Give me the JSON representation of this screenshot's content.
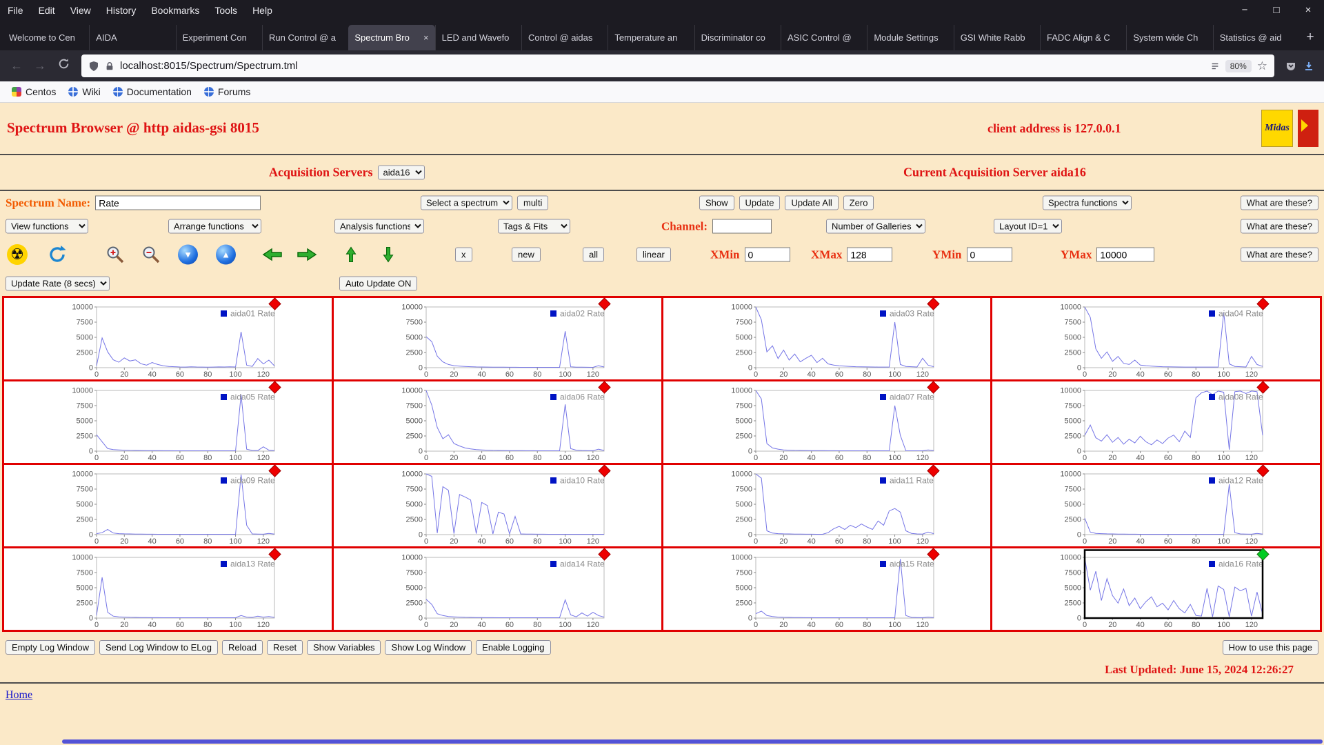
{
  "browser": {
    "menu": [
      "File",
      "Edit",
      "View",
      "History",
      "Bookmarks",
      "Tools",
      "Help"
    ],
    "window_controls": {
      "minimize": "−",
      "maximize": "□",
      "close": "×"
    },
    "tabs": [
      "Welcome to Cen",
      "AIDA",
      "Experiment Con",
      "Run Control @ a",
      "Spectrum Bro",
      "LED and Wavefo",
      "Control @ aidas",
      "Temperature an",
      "Discriminator co",
      "ASIC Control @",
      "Module Settings",
      "GSI White Rabb",
      "FADC Align & C",
      "System wide Ch",
      "Statistics @ aid"
    ],
    "active_tab": 4,
    "new_tab": "+",
    "url": "localhost:8015/Spectrum/Spectrum.tml",
    "zoom": "80%",
    "bookmarks": [
      "Centos",
      "Wiki",
      "Documentation",
      "Forums"
    ]
  },
  "header": {
    "title": "Spectrum Browser @ http aidas-gsi 8015",
    "client": "client address is 127.0.0.1",
    "logo_text": "Midas"
  },
  "acquisition": {
    "label": "Acquisition Servers",
    "selected": "aida16",
    "current": "Current Acquisition Server aida16"
  },
  "controls": {
    "spectrum_name_label": "Spectrum Name:",
    "spectrum_name_value": "Rate",
    "select_spectrum": "Select a spectrum",
    "multi": "multi",
    "show": "Show",
    "update": "Update",
    "update_all": "Update All",
    "zero": "Zero",
    "spectra_functions": "Spectra functions",
    "what_are_these": "What are these?",
    "view_functions": "View functions",
    "arrange_functions": "Arrange functions",
    "analysis_functions": "Analysis functions",
    "tags_fits": "Tags & Fits",
    "channel_label": "Channel:",
    "channel_value": "",
    "number_of_galleries": "Number of Galleries",
    "layout_id": "Layout ID=1",
    "x_btn": "x",
    "new_btn": "new",
    "all_btn": "all",
    "linear_btn": "linear",
    "xmin_label": "XMin",
    "xmin_value": "0",
    "xmax_label": "XMax",
    "xmax_value": "128",
    "ymin_label": "YMin",
    "ymin_value": "0",
    "ymax_label": "YMax",
    "ymax_value": "10000",
    "update_rate": "Update Rate (8 secs)",
    "auto_update": "Auto Update ON"
  },
  "footer": {
    "buttons": [
      "Empty Log Window",
      "Send Log Window to ELog",
      "Reload",
      "Reset",
      "Show Variables",
      "Show Log Window",
      "Enable Logging"
    ],
    "help": "How to use this page",
    "last_updated": "Last Updated: June 15, 2024 12:26:27",
    "home": "Home"
  },
  "chart_data": {
    "type": "line",
    "xlabel": "",
    "ylabel": "",
    "xlim": [
      0,
      128
    ],
    "ylim": [
      0,
      10000
    ],
    "x_ticks": [
      0,
      20,
      40,
      60,
      80,
      100,
      120
    ],
    "y_ticks": [
      0,
      2500,
      5000,
      7500,
      10000
    ],
    "x_step": 4,
    "line_color": "#7575e6",
    "legend_marker_color": "#0013c4",
    "charts": [
      {
        "name": "aida01 Rate",
        "diamond": "#ee0000",
        "values": [
          300,
          4900,
          2600,
          1300,
          900,
          1600,
          1100,
          1300,
          650,
          420,
          850,
          520,
          320,
          210,
          160,
          110,
          100,
          150,
          110,
          100,
          90,
          100,
          130,
          110,
          150,
          110,
          5900,
          420,
          210,
          1500,
          620,
          1250,
          300
        ]
      },
      {
        "name": "aida02 Rate",
        "diamond": "#ee0000",
        "values": [
          5100,
          4300,
          1900,
          950,
          520,
          330,
          260,
          210,
          160,
          130,
          110,
          100,
          90,
          80,
          80,
          70,
          70,
          60,
          60,
          60,
          60,
          60,
          60,
          60,
          60,
          6000,
          150,
          90,
          80,
          70,
          60,
          320,
          110
        ]
      },
      {
        "name": "aida03 Rate",
        "diamond": "#ee0000",
        "values": [
          10000,
          7900,
          2600,
          3600,
          1500,
          2900,
          1250,
          2250,
          950,
          1550,
          2050,
          850,
          1550,
          620,
          420,
          320,
          260,
          210,
          160,
          150,
          130,
          110,
          100,
          100,
          110,
          7500,
          520,
          210,
          160,
          110,
          1550,
          420,
          160
        ]
      },
      {
        "name": "aida04 Rate",
        "diamond": "#ee0000",
        "values": [
          10000,
          8300,
          3100,
          1550,
          2600,
          1050,
          1850,
          720,
          520,
          1250,
          420,
          330,
          260,
          210,
          160,
          150,
          130,
          110,
          100,
          100,
          100,
          100,
          100,
          100,
          110,
          9100,
          620,
          210,
          160,
          110,
          1850,
          520,
          210
        ]
      },
      {
        "name": "aida05 Rate",
        "diamond": "#ee0000",
        "values": [
          2700,
          1550,
          420,
          260,
          210,
          160,
          130,
          110,
          100,
          90,
          80,
          80,
          70,
          70,
          60,
          60,
          60,
          60,
          60,
          60,
          60,
          60,
          60,
          60,
          60,
          60,
          9300,
          320,
          110,
          90,
          720,
          160,
          90
        ]
      },
      {
        "name": "aida06 Rate",
        "diamond": "#ee0000",
        "values": [
          10000,
          7600,
          3900,
          2050,
          2700,
          1250,
          850,
          520,
          360,
          260,
          210,
          160,
          130,
          110,
          100,
          90,
          80,
          80,
          70,
          70,
          60,
          60,
          60,
          60,
          60,
          7700,
          420,
          160,
          110,
          90,
          80,
          320,
          110
        ]
      },
      {
        "name": "aida07 Rate",
        "diamond": "#ee0000",
        "values": [
          10000,
          8600,
          1250,
          520,
          330,
          210,
          160,
          130,
          110,
          100,
          90,
          80,
          80,
          70,
          70,
          60,
          60,
          60,
          60,
          60,
          60,
          60,
          60,
          60,
          60,
          7500,
          2600,
          60,
          60,
          60,
          60,
          210,
          90
        ]
      },
      {
        "name": "aida08 Rate",
        "diamond": "#ee0000",
        "values": [
          2600,
          4300,
          2200,
          1650,
          2700,
          1450,
          2250,
          1150,
          1950,
          1350,
          2450,
          1550,
          1050,
          1850,
          1250,
          2150,
          2650,
          1550,
          3300,
          2250,
          8800,
          9600,
          9900,
          9300,
          9900,
          9700,
          250,
          9800,
          9900,
          9500,
          9900,
          9800,
          2600
        ]
      },
      {
        "name": "aida09 Rate",
        "diamond": "#ee0000",
        "values": [
          160,
          320,
          850,
          260,
          160,
          130,
          110,
          90,
          80,
          70,
          70,
          60,
          60,
          60,
          60,
          60,
          60,
          60,
          60,
          60,
          60,
          60,
          60,
          60,
          60,
          60,
          9900,
          1550,
          110,
          90,
          70,
          210,
          90
        ]
      },
      {
        "name": "aida10 Rate",
        "diamond": "#ee0000",
        "values": [
          10000,
          9600,
          250,
          7900,
          7300,
          160,
          6600,
          6200,
          5700,
          160,
          5300,
          4800,
          110,
          3700,
          3400,
          110,
          3000,
          110,
          90,
          80,
          70,
          70,
          60,
          60,
          60,
          60,
          60,
          60,
          60,
          60,
          60,
          60,
          60
        ]
      },
      {
        "name": "aida11 Rate",
        "diamond": "#ee0000",
        "values": [
          10000,
          9300,
          620,
          260,
          160,
          130,
          110,
          90,
          80,
          70,
          70,
          60,
          60,
          320,
          950,
          1350,
          850,
          1550,
          1150,
          1750,
          1250,
          850,
          2250,
          1550,
          3900,
          4300,
          3700,
          620,
          210,
          110,
          90,
          420,
          160
        ]
      },
      {
        "name": "aida12 Rate",
        "diamond": "#ee0000",
        "values": [
          2700,
          420,
          210,
          160,
          130,
          110,
          90,
          80,
          70,
          70,
          60,
          60,
          60,
          60,
          60,
          60,
          60,
          60,
          60,
          60,
          60,
          60,
          60,
          60,
          60,
          60,
          8300,
          320,
          110,
          90,
          70,
          210,
          90
        ]
      },
      {
        "name": "aida13 Rate",
        "diamond": "#ee0000",
        "values": [
          420,
          6700,
          950,
          320,
          210,
          160,
          130,
          110,
          90,
          80,
          70,
          70,
          60,
          60,
          60,
          60,
          60,
          60,
          60,
          60,
          60,
          60,
          60,
          60,
          60,
          60,
          420,
          160,
          110,
          320,
          160,
          260,
          110
        ]
      },
      {
        "name": "aida14 Rate",
        "diamond": "#ee0000",
        "values": [
          3100,
          2250,
          720,
          420,
          260,
          210,
          160,
          130,
          110,
          90,
          80,
          70,
          70,
          60,
          60,
          60,
          60,
          60,
          60,
          60,
          60,
          60,
          60,
          60,
          60,
          3000,
          520,
          210,
          850,
          320,
          950,
          420,
          160
        ]
      },
      {
        "name": "aida15 Rate",
        "diamond": "#ee0000",
        "values": [
          720,
          1150,
          420,
          260,
          160,
          130,
          110,
          90,
          80,
          70,
          70,
          60,
          60,
          60,
          60,
          60,
          60,
          60,
          60,
          60,
          60,
          60,
          60,
          60,
          60,
          60,
          9700,
          420,
          110,
          90,
          70,
          160,
          90
        ]
      },
      {
        "name": "aida16 Rate",
        "diamond": "#00cc22",
        "selected": true,
        "values": [
          9900,
          4600,
          7700,
          2900,
          6500,
          3700,
          2450,
          4800,
          2050,
          3300,
          1550,
          2700,
          3500,
          1850,
          2450,
          1350,
          2900,
          1550,
          850,
          2250,
          420,
          330,
          4900,
          210,
          5300,
          4700,
          210,
          5100,
          4500,
          4900,
          320,
          4300,
          620
        ]
      }
    ]
  }
}
